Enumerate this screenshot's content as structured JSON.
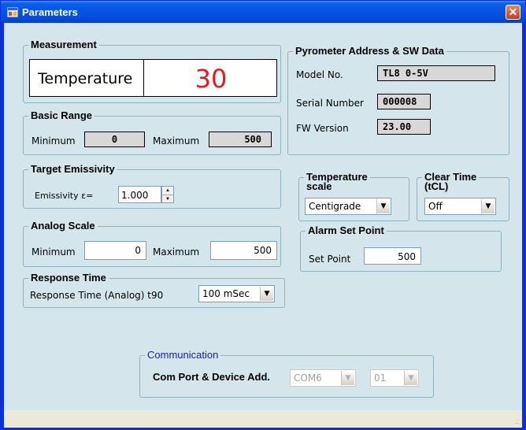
{
  "window": {
    "title": "Parameters",
    "close_glyph": "✕"
  },
  "measurement": {
    "legend": "Measurement",
    "label": "Temperature",
    "value": "30",
    "value_color": "#e8191d"
  },
  "basic_range": {
    "legend": "Basic Range",
    "min_label": "Minimum",
    "min_value": "0",
    "max_label": "Maximum",
    "max_value": "500"
  },
  "pyrometer": {
    "legend": "Pyrometer Address & SW Data",
    "model_label": "Model No.",
    "model_value": "TL8 0-5V",
    "serial_label": "Serial Number",
    "serial_value": "000008",
    "fw_label": "FW Version",
    "fw_value": "23.00"
  },
  "emissivity": {
    "legend": "Target Emissivity",
    "label": "Emissivity ε=",
    "value": "1.000",
    "up_glyph": "▲",
    "down_glyph": "▼"
  },
  "temperature_scale": {
    "legend_line1": "Temperature",
    "legend_line2": "scale",
    "selected": "Centigrade"
  },
  "clear_time": {
    "legend_line1": "Clear Time",
    "legend_line2": "(tCL)",
    "selected": "Off"
  },
  "analog_scale": {
    "legend": "Analog Scale",
    "min_label": "Minimum",
    "min_value": "0",
    "max_label": "Maximum",
    "max_value": "500"
  },
  "alarm": {
    "legend": "Alarm Set Point",
    "label": "Set Point",
    "value": "500"
  },
  "response_time": {
    "legend": "Response Time",
    "label": "Response Time  (Analog)  t90",
    "selected": "100 mSec"
  },
  "communication": {
    "legend": "Communication",
    "label": "Com Port & Device Add.",
    "port": "COM6",
    "device": "01"
  },
  "dropdown_glyph": "▼",
  "status": {
    "grip": ".:"
  }
}
